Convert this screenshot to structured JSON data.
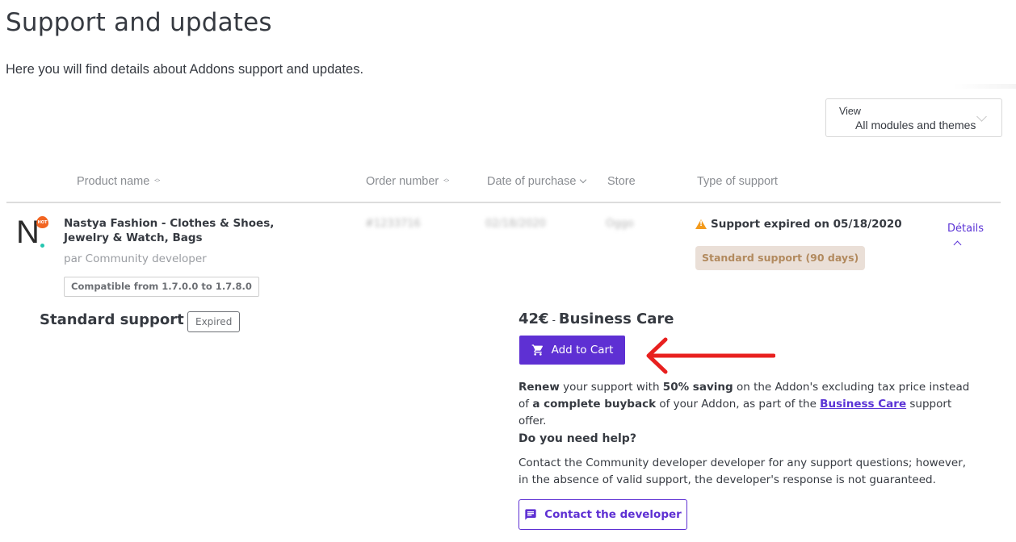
{
  "header": {
    "title": "Support and updates",
    "subtitle": "Here you will find details about Addons support and updates."
  },
  "view_filter": {
    "label": "View",
    "value": "All modules and themes"
  },
  "table": {
    "columns": [
      {
        "label": "Product name",
        "sort": "both"
      },
      {
        "label": "Order number",
        "sort": "both"
      },
      {
        "label": "Date of purchase",
        "sort": "desc"
      },
      {
        "label": "Store",
        "sort": "none"
      },
      {
        "label": "Type of support",
        "sort": "none"
      }
    ],
    "rows": [
      {
        "logo": {
          "letter": "N",
          "badge": "HOT",
          "accent": "#f26522",
          "dot_color": "#25c6b0"
        },
        "product_name": "Nastya Fashion - Clothes & Shoes, Jewelry & Watch, Bags",
        "author": "par Community developer",
        "compatibility": "Compatible from 1.7.0.0 to 1.7.8.0",
        "order_number": "#1233716",
        "date_of_purchase": "02/18/2020",
        "store": "Oggo",
        "status_text": "Support expired on 05/18/2020",
        "support_type": "Standard support (90 days)",
        "details_label": "Détails"
      }
    ]
  },
  "details_panel": {
    "plan_title": "Standard support",
    "plan_status": "Expired",
    "offer": {
      "price": "42€",
      "separator": "-",
      "name": "Business Care",
      "add_to_cart_label": "Add to Cart"
    },
    "renew": {
      "part1_bold": "Renew",
      "part2": " your support with ",
      "part3_bold": "50% saving",
      "part4": " on the Addon's excluding tax price instead of ",
      "part5_bold": "a complete buyback",
      "part6": " of your Addon, as part of the ",
      "link": "Business Care",
      "part7": " support offer."
    },
    "help": {
      "title": "Do you need help?",
      "text": "Contact the Community developer developer for any support questions; however, in the absence of valid support, the developer's response is not guaranteed.",
      "contact_label": "Contact the developer"
    }
  },
  "colors": {
    "brand": "#5e30d3",
    "warning": "#f39a1c",
    "support_pill_bg": "#eadfd7",
    "support_pill_text": "#b28a5e",
    "annotation_arrow": "#e8201f"
  }
}
